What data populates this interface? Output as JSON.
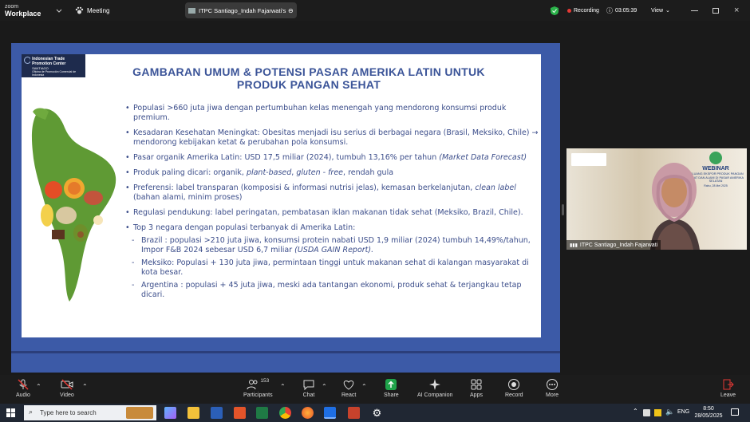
{
  "topbar": {
    "brand_line1": "zoom",
    "brand_line2": "Workplace",
    "meeting_label": "Meeting",
    "meeting_tab": "ITPC Santiago_Indah Fajarwati's s...",
    "recording_label": "Recording",
    "timer": "03:05:39",
    "view_label": "View"
  },
  "slide": {
    "logo_line1": "Indonesian Trade",
    "logo_line2": "Promotion Center",
    "logo_line3": "SANTIAGO",
    "logo_line4": "Oficina de Promoción Comercial de Indonesia",
    "title_line1": "GAMBARAN UMUM & POTENSI PASAR AMERIKA LATIN UNTUK",
    "title_line2": "PRODUK PANGAN SEHAT",
    "bullets": [
      {
        "text": "Populasi >660 juta jiwa dengan pertumbuhan kelas menengah yang mendorong konsumsi produk premium."
      },
      {
        "text": "Kesadaran Kesehatan Meningkat: Obesitas menjadi isu serius di berbagai negara (Brasil, Meksiko, Chile) → mendorong kebijakan ketat & perubahan pola konsumsi."
      },
      {
        "text": "Pasar organik Amerika Latin: USD 17,5 miliar (2024), tumbuh 13,16% per tahun ",
        "italic": "(Market Data Forecast)"
      },
      {
        "text": "Produk paling dicari: organik, ",
        "italic": "plant-based",
        "text2": ", ",
        "italic2": "gluten - free",
        "text3": ", rendah gula"
      },
      {
        "text": "Preferensi: label transparan (komposisi & informasi nutrisi jelas), kemasan berkelanjutan, ",
        "italic": "clean label",
        "text2": " (bahan alami, minim proses)"
      },
      {
        "text": "Regulasi pendukung: label peringatan, pembatasan iklan makanan tidak sehat (Meksiko, Brazil, Chile)."
      },
      {
        "text": "Top 3 negara dengan populasi terbanyak di Amerika Latin:"
      }
    ],
    "subs": [
      {
        "text": "Brazil : populasi >210 juta jiwa, konsumsi protein nabati USD 1,9  miliar (2024) tumbuh 14,49%/tahun, Impor F&B 2024 sebesar  USD 6,7 miliar ",
        "italic": "(USDA GAIN Report)."
      },
      {
        "text": "Meksiko: Populasi + 130 juta jiwa, permintaan tinggi untuk makanan sehat di kalangan masyarakat di kota besar."
      },
      {
        "text": "Argentina : populasi + 45 juta jiwa, meski ada tantangan ekonomi, produk sehat & terjangkau tetap dicari."
      }
    ]
  },
  "video": {
    "participant_name": "ITPC Santiago_Indah Fajarwati",
    "banner_title": "WEBINAR",
    "banner_text": "PELUANG EKSPOR PRODUK PANGAN SEHAT DAN ALAMI DI PASAR AMERIKA SELATAN",
    "banner_date": "Rabu, 28 Mei 2025"
  },
  "controls": {
    "audio": "Audio",
    "video": "Video",
    "participants": "Participants",
    "participants_count": "153",
    "chat": "Chat",
    "react": "React",
    "share": "Share",
    "ai": "AI Companion",
    "apps": "Apps",
    "record": "Record",
    "more": "More",
    "leave": "Leave"
  },
  "taskbar": {
    "search_placeholder": "Type here to search",
    "lang": "ENG",
    "time": "8:50",
    "date": "28/05/2025"
  },
  "colors": {
    "accent": "#3b5498",
    "slide_frame": "#3c5aa7",
    "recording": "#e53935",
    "share": "#1fa34a"
  }
}
